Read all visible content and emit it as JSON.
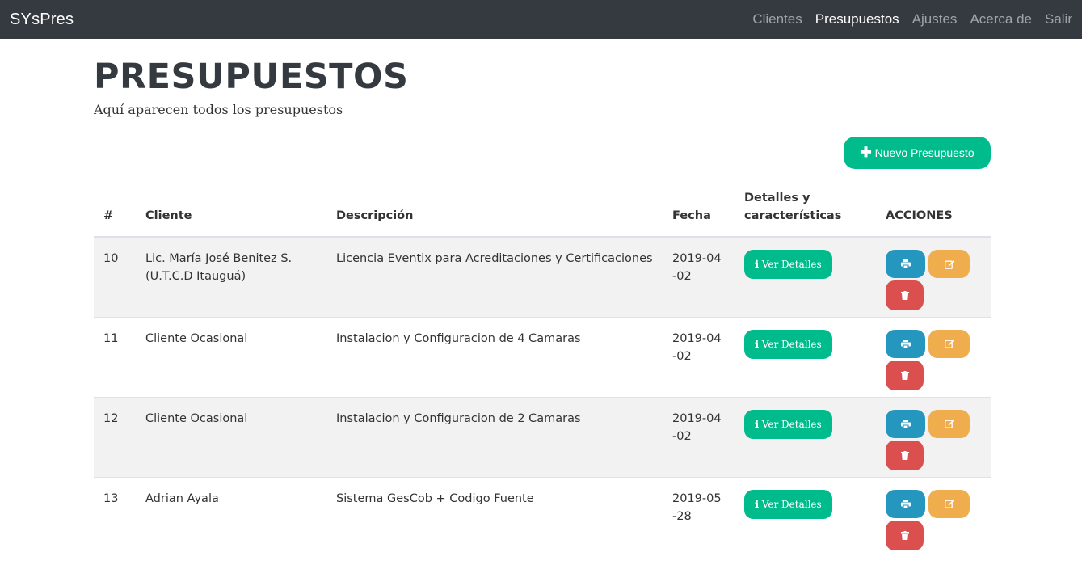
{
  "navbar": {
    "brand": "SYsPres",
    "links": [
      "Clientes",
      "Presupuestos",
      "Ajustes",
      "Acerca de",
      "Salir"
    ],
    "active": "Presupuestos"
  },
  "page": {
    "title": "PRESUPUESTOS",
    "subtitle": "Aquí aparecen todos los presupuestos",
    "new_button": "Nuevo Presupuesto"
  },
  "table": {
    "headers": [
      "#",
      "Cliente",
      "Descripción",
      "Fecha",
      "Detalles y características",
      "ACCIONES"
    ],
    "details_button": "Ver Detalles",
    "rows": [
      {
        "id": "10",
        "cliente": "Lic. María José Benitez S. (U.T.C.D Itauguá)",
        "descripcion": "Licencia Eventix para Acreditaciones y Certificaciones",
        "fecha": "2019-04-02"
      },
      {
        "id": "11",
        "cliente": "Cliente Ocasional",
        "descripcion": "Instalacion y Configuracion de 4 Camaras",
        "fecha": "2019-04-02"
      },
      {
        "id": "12",
        "cliente": "Cliente Ocasional",
        "descripcion": "Instalacion y Configuracion de 2 Camaras",
        "fecha": "2019-04-02"
      },
      {
        "id": "13",
        "cliente": "Adrian Ayala",
        "descripcion": "Sistema GesCob + Codigo Fuente",
        "fecha": "2019-05-28"
      }
    ]
  },
  "icons": {
    "plus": "plus-icon",
    "info": "info-icon",
    "print": "print-icon",
    "edit": "edit-icon",
    "delete": "trash-icon"
  },
  "colors": {
    "navbar": "#343a40",
    "success": "#00bc8c",
    "info": "#2596be",
    "warning": "#f0ad4e",
    "danger": "#dc4f4f"
  }
}
